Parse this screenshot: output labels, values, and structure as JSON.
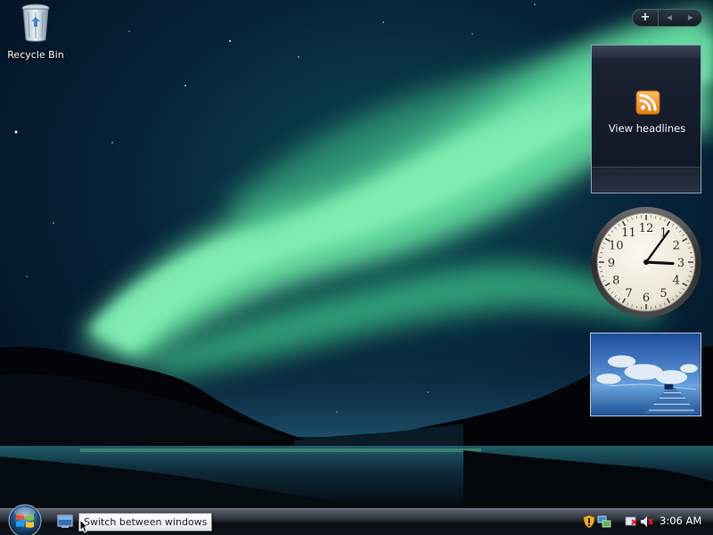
{
  "desktop": {
    "icons": [
      {
        "label": "Recycle Bin",
        "icon": "recycle-bin-icon"
      }
    ]
  },
  "sidebar": {
    "controls": {
      "add_label": "+",
      "prev_label": "◀",
      "next_label": "▶"
    },
    "feed_gadget": {
      "label": "View headlines",
      "icon": "rss-feed-icon",
      "accent": "#f39a1e"
    },
    "clock_gadget": {
      "time": "3:06",
      "numerals": [
        "12",
        "1",
        "2",
        "3",
        "4",
        "5",
        "6",
        "7",
        "8",
        "9",
        "10",
        "11"
      ]
    },
    "slideshow_gadget": {
      "icon": "slideshow-image"
    }
  },
  "taskbar": {
    "start_button": {
      "icon": "windows-start-orb-icon"
    },
    "quick_launch": [
      {
        "icon": "show-desktop-icon"
      },
      {
        "icon": "switch-windows-icon"
      }
    ],
    "tooltip": "Switch between windows",
    "tray": {
      "icons": [
        "security-shield-icon",
        "network-icon",
        "power-icon",
        "volume-muted-icon"
      ],
      "clock": "3:06 AM"
    }
  },
  "colors": {
    "aurora": "#4fd896",
    "sky_dark": "#031225",
    "taskbar": "#10151b",
    "rss_orange": "#f39a1e"
  }
}
